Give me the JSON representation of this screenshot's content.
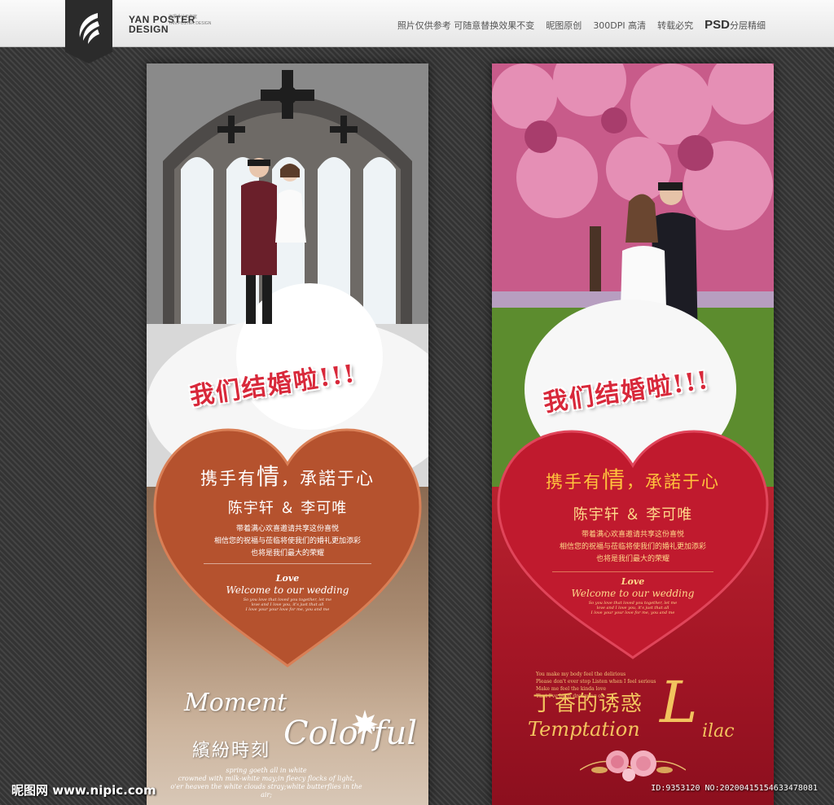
{
  "header": {
    "brand_line1": "YAN POSTER",
    "brand_line2": "DESIGN",
    "brand_small_1": "海报设计工作室",
    "brand_small_2": "YAN POSTER DESIGN",
    "notes": [
      "照片仅供参考 可随意替换效果不变",
      "昵图原创",
      "300DPI 高清",
      "转载必究"
    ],
    "psd": "PSD",
    "psd_sub": "分层精细"
  },
  "poster_left": {
    "headline": "我们结婚啦!!!",
    "vow_a": "携手有",
    "vow_big": "情",
    "vow_b": "，承諾于心",
    "names": "陈宇轩 ＆ 李可唯",
    "invite": [
      "带着满心欢喜邀请共享这份喜悦",
      "相信您的祝福与莅临将使我们的婚礼更加添彩",
      "也将是我们最大的荣耀"
    ],
    "love": "Love",
    "welcome": "Welcome to our wedding",
    "tiny_lines": [
      "So you love that loved you together, let me",
      "love and I love you, it's just that all",
      "I love your your love for me, you and me"
    ],
    "moment": "Moment",
    "colorful": "Colorful",
    "binfen": "繽紛時刻",
    "spring": [
      "spring goeth all in white",
      "crowned with milk-white may;in fleecy flocks of light,",
      "o'er heaven the white clouds stray;white butterflies in the air;"
    ]
  },
  "poster_right": {
    "headline": "我们结婚啦!!!",
    "vow_a": "携手有",
    "vow_big": "情",
    "vow_b": "，承諾于心",
    "names": "陈宇轩 ＆ 李可唯",
    "invite": [
      "带着满心欢喜邀请共享这份喜悦",
      "相信您的祝福与莅临将使我们的婚礼更加添彩",
      "也将是我们最大的荣耀"
    ],
    "love": "Love",
    "welcome": "Welcome to our wedding",
    "tiny_lines": [
      "So you love that loved you together, let me",
      "love and I love you, it's just that all",
      "I love your your love for me, you and me"
    ],
    "verse": [
      "You make my body feel the delirious",
      "Please don't ever stop Listen when I feel serious",
      "Make me feel the kinda love",
      "That I've been dreaming of"
    ],
    "lilac_cn": "丁香的诱惑",
    "lilac_l": "L",
    "lilac_en": "Temptation",
    "lilac_en2": "ilac"
  },
  "watermark": {
    "site": "昵图网 www.nipic.com",
    "id": "ID:9353120 NO:20200415154633478081"
  },
  "colors": {
    "left_heart": "#b5522e",
    "right_heart": "#c01a2e",
    "headline": "#d8283a",
    "gold": "#f2c35e"
  }
}
